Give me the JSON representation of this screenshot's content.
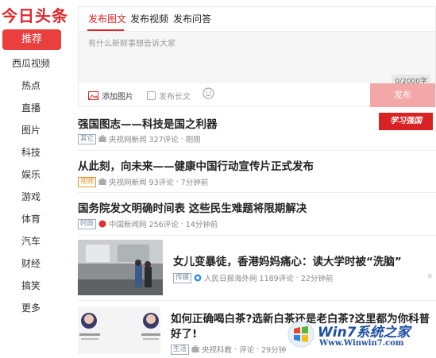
{
  "logo": "今日头条",
  "nav": {
    "active": "推荐",
    "items": [
      "西瓜视频",
      "热点",
      "直播",
      "图片",
      "科技",
      "娱乐",
      "游戏",
      "体育",
      "汽车",
      "财经",
      "搞笑",
      "更多"
    ]
  },
  "editor": {
    "tabs": [
      "发布图文",
      "发布视频",
      "发布问答"
    ],
    "placeholder": "有什么新鲜事想告诉大家",
    "count": "0/2000字",
    "add_image": "添加图片",
    "long_text": "发布长文",
    "publish": "发布"
  },
  "articles": [
    {
      "title": "强国图志——科技是国之利器",
      "tag": "其它",
      "source": "央视网新闻",
      "comments": "327评论",
      "time": "刚刚",
      "badge": "学习强国"
    },
    {
      "title": "从此刻，向未来——健康中国行动宣传片正式发布",
      "tag": "视频",
      "source": "央视网新闻",
      "comments": "93评论",
      "time": "7分钟前"
    },
    {
      "title": "国务院发文明确时间表 这些民生难题将限期解决",
      "tag": "时政",
      "source": "中国新闻网",
      "comments": "256评论",
      "time": "14分钟前"
    },
    {
      "title": "女儿变暴徒，香港妈妈痛心：读大学时被“洗脑”",
      "tag": "传媒",
      "source": "人民日报海外网",
      "comments": "1189评论",
      "time": "22分钟前"
    },
    {
      "title_line1": "如何正确喝白茶?选新白茶还是老白茶?这里都为你科普",
      "title_line2": "好了!",
      "tag": "生活",
      "source": "央视科教",
      "comments": "评论",
      "time": "29分钟"
    }
  ],
  "watermark": {
    "brand": "Win7系统之家",
    "url": "Www.Winwin7.com"
  },
  "colors": {
    "accent": "#e0262b",
    "nav_active": "#e9403f",
    "publish": "#f3a7a7"
  }
}
